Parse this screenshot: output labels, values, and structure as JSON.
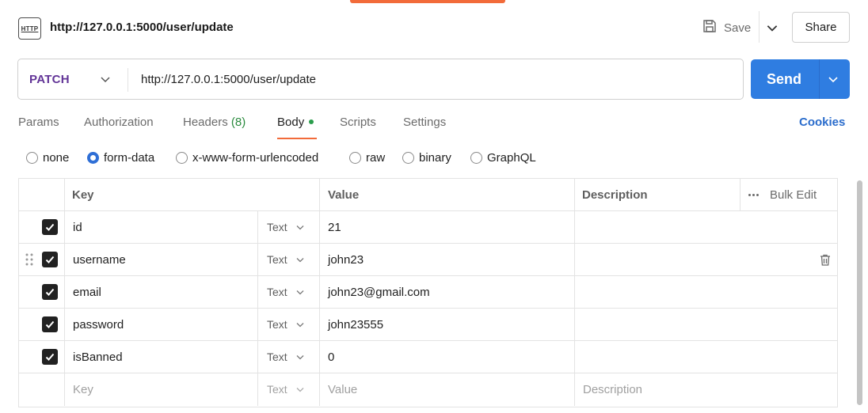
{
  "header": {
    "icon_label": "HTTP",
    "title": "http://127.0.0.1:5000/user/update",
    "save_label": "Save",
    "share_label": "Share"
  },
  "request": {
    "method": "PATCH",
    "url": "http://127.0.0.1:5000/user/update",
    "send_label": "Send"
  },
  "tabs": [
    {
      "label": "Params"
    },
    {
      "label": "Authorization"
    },
    {
      "label": "Headers",
      "count": "(8)"
    },
    {
      "label": "Body",
      "active": true
    },
    {
      "label": "Scripts"
    },
    {
      "label": "Settings"
    }
  ],
  "cookies_label": "Cookies",
  "body_types": [
    {
      "label": "none",
      "selected": false
    },
    {
      "label": "form-data",
      "selected": true
    },
    {
      "label": "x-www-form-urlencoded",
      "selected": false
    },
    {
      "label": "raw",
      "selected": false
    },
    {
      "label": "binary",
      "selected": false
    },
    {
      "label": "GraphQL",
      "selected": false
    }
  ],
  "table": {
    "columns": [
      "Key",
      "Value",
      "Description"
    ],
    "bulk_edit_label": "Bulk Edit",
    "rows": [
      {
        "checked": true,
        "key": "id",
        "type": "Text",
        "value": "21",
        "description": ""
      },
      {
        "checked": true,
        "key": "username",
        "type": "Text",
        "value": "john23",
        "description": ""
      },
      {
        "checked": true,
        "key": "email",
        "type": "Text",
        "value": "john23@gmail.com",
        "description": ""
      },
      {
        "checked": true,
        "key": "password",
        "type": "Text",
        "value": "john23555",
        "description": ""
      },
      {
        "checked": true,
        "key": "isBanned",
        "type": "Text",
        "value": "0",
        "description": ""
      }
    ],
    "new_row": {
      "key_placeholder": "Key",
      "type": "Text",
      "value_placeholder": "Value",
      "description_placeholder": "Description"
    }
  },
  "colors": {
    "accent": "#f26b3a",
    "send": "#2f7de1",
    "method": "#623497",
    "link": "#2a6ccc"
  }
}
